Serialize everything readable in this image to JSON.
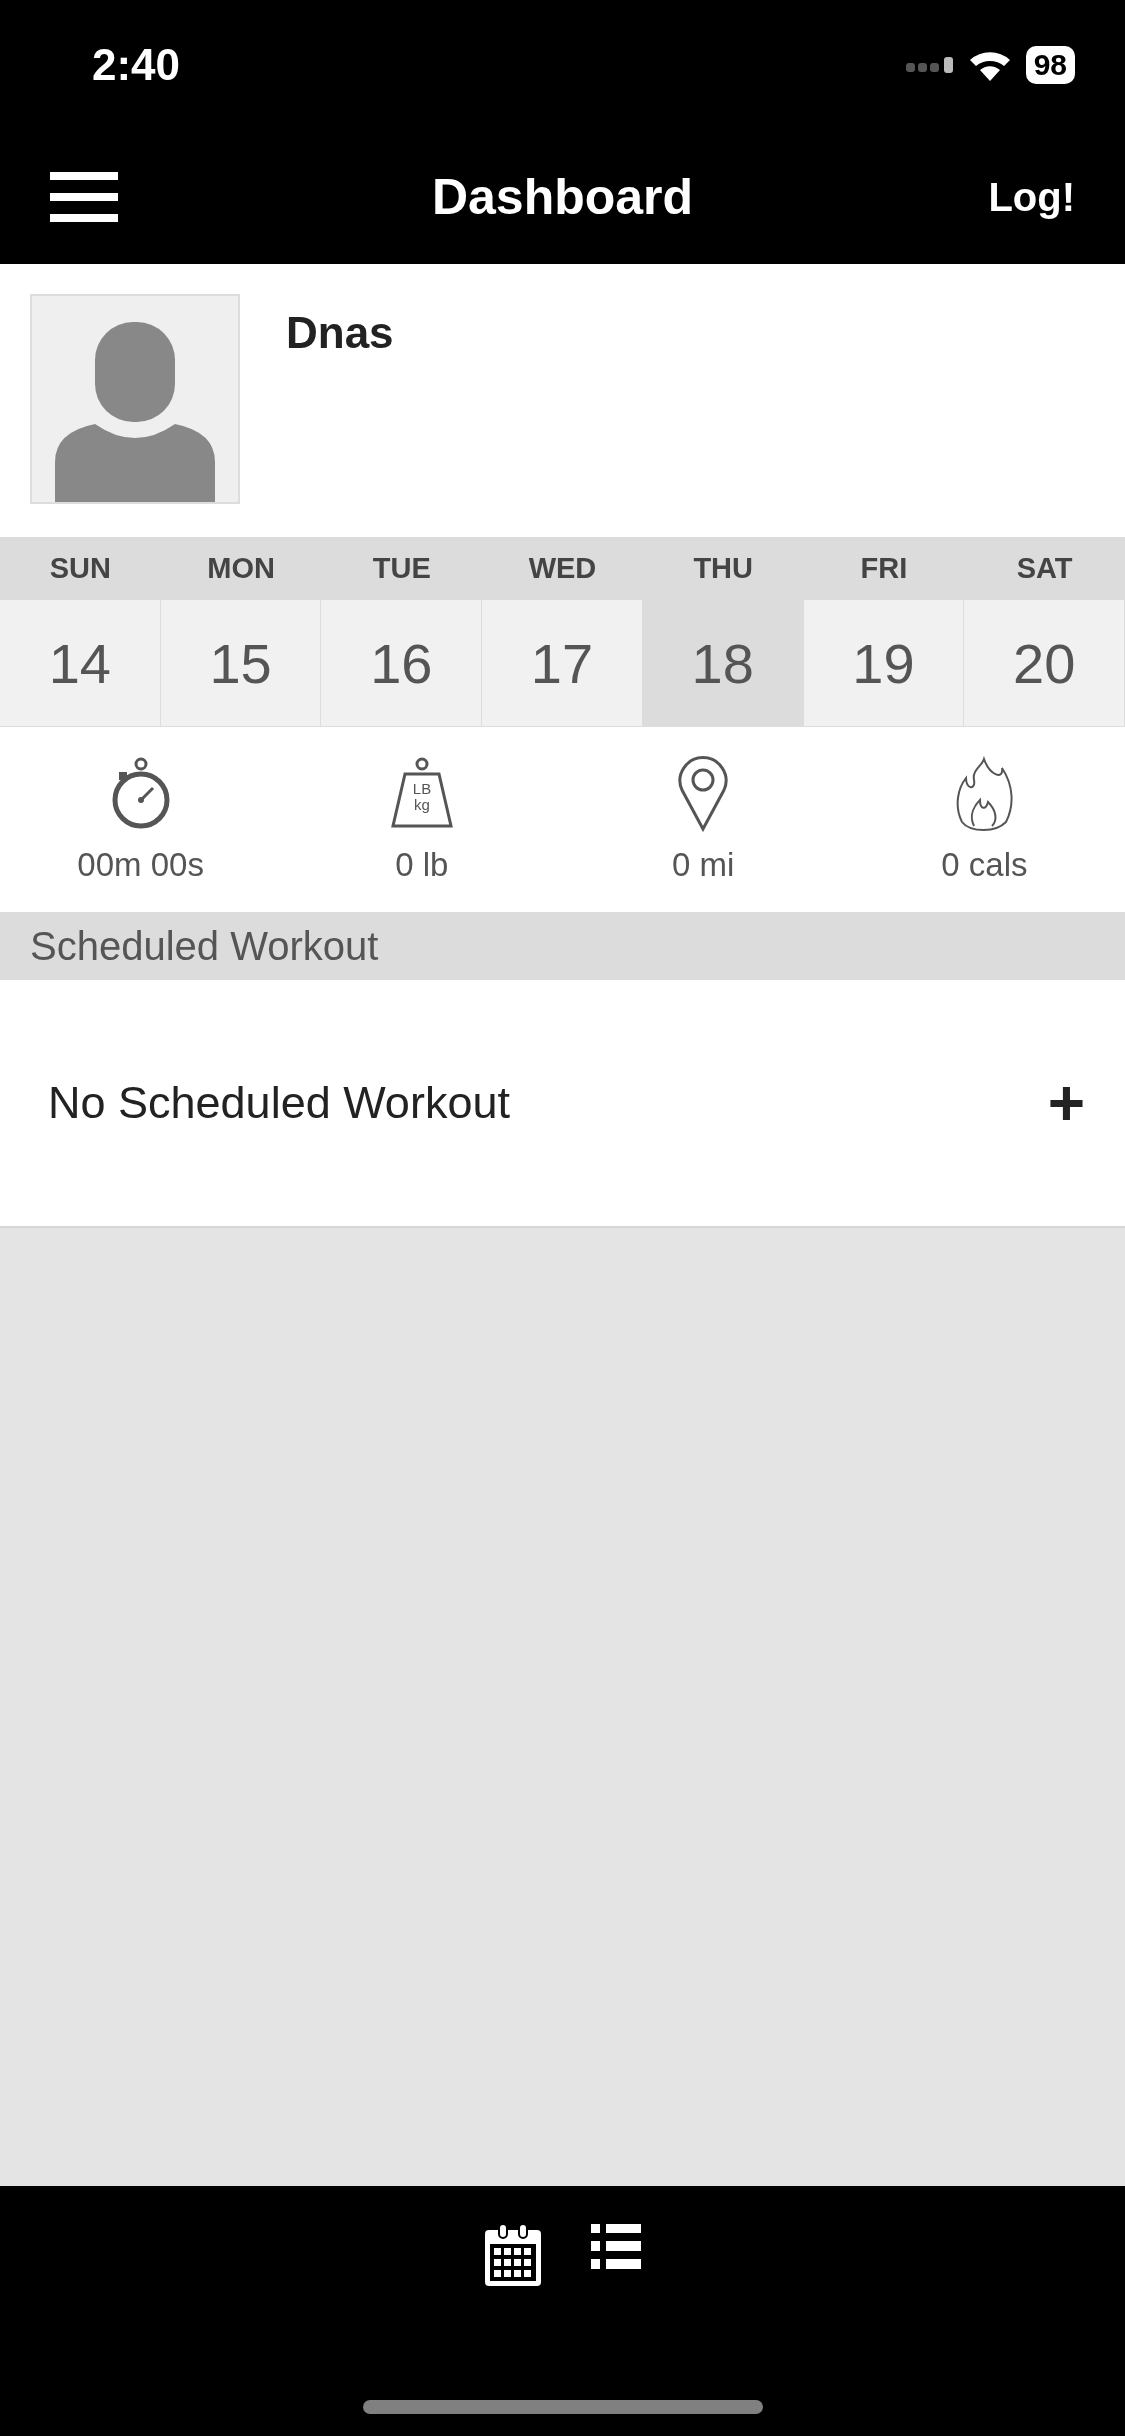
{
  "status_bar": {
    "time": "2:40",
    "battery": "98"
  },
  "header": {
    "title": "Dashboard",
    "action": "Log!"
  },
  "profile": {
    "name": "Dnas"
  },
  "week": [
    {
      "day": "SUN",
      "date": "14",
      "selected": false
    },
    {
      "day": "MON",
      "date": "15",
      "selected": false
    },
    {
      "day": "TUE",
      "date": "16",
      "selected": false
    },
    {
      "day": "WED",
      "date": "17",
      "selected": false
    },
    {
      "day": "THU",
      "date": "18",
      "selected": true
    },
    {
      "day": "FRI",
      "date": "19",
      "selected": false
    },
    {
      "day": "SAT",
      "date": "20",
      "selected": false
    }
  ],
  "stats": [
    {
      "kind": "time",
      "value": "00m 00s"
    },
    {
      "kind": "weight",
      "value": "0 lb",
      "icon_lines": [
        "LB",
        "kg"
      ]
    },
    {
      "kind": "distance",
      "value": "0 mi"
    },
    {
      "kind": "calories",
      "value": "0 cals"
    }
  ],
  "section": {
    "title": "Scheduled Workout"
  },
  "scheduled": {
    "text": "No Scheduled Workout",
    "action": "+"
  },
  "tab_bar": [
    {
      "kind": "calendar"
    },
    {
      "kind": "list"
    }
  ]
}
